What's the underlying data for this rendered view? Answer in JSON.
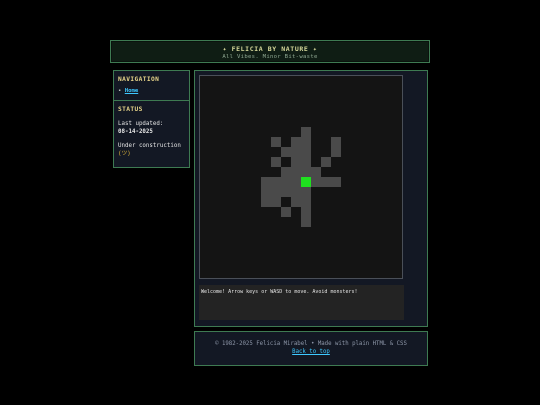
{
  "header": {
    "title": "✦ FELICIA BY NATURE ✦",
    "subtitle": "All Vibes. Minor Bit-waste"
  },
  "sidebar": {
    "navigation": {
      "heading": "NAVIGATION",
      "bullet": "•",
      "items": [
        {
          "label": "Home"
        }
      ]
    },
    "status": {
      "heading": "STATUS",
      "updated_label": "Last updated:",
      "updated_value": "08-14-2025",
      "construction_text": "Under construction",
      "construction_badge": "(ツ)"
    }
  },
  "game": {
    "message": "Welcome! Arrow keys or WASD to move. Avoid monsters!",
    "colors": {
      "floor": "#4a4a4a",
      "player": "#1fe01f",
      "background": "#141414"
    },
    "floor_tiles": [
      [
        10,
        5
      ],
      [
        7,
        6
      ],
      [
        9,
        6
      ],
      [
        10,
        6
      ],
      [
        13,
        6
      ],
      [
        8,
        7
      ],
      [
        9,
        7
      ],
      [
        10,
        7
      ],
      [
        13,
        7
      ],
      [
        7,
        8
      ],
      [
        9,
        8
      ],
      [
        10,
        8
      ],
      [
        12,
        8
      ],
      [
        8,
        9
      ],
      [
        9,
        9
      ],
      [
        10,
        9
      ],
      [
        11,
        9
      ],
      [
        6,
        10
      ],
      [
        7,
        10
      ],
      [
        8,
        10
      ],
      [
        9,
        10
      ],
      [
        11,
        10
      ],
      [
        12,
        10
      ],
      [
        13,
        10
      ],
      [
        6,
        11
      ],
      [
        7,
        11
      ],
      [
        8,
        11
      ],
      [
        9,
        11
      ],
      [
        10,
        11
      ],
      [
        6,
        12
      ],
      [
        7,
        12
      ],
      [
        9,
        12
      ],
      [
        10,
        12
      ],
      [
        8,
        13
      ],
      [
        10,
        13
      ],
      [
        10,
        14
      ]
    ],
    "player_tile": [
      10,
      10
    ]
  },
  "footer": {
    "copyright": "© 1982-2025 Felicia Mirabel • Made with plain HTML & CSS",
    "back_to_top": "Back to top"
  }
}
